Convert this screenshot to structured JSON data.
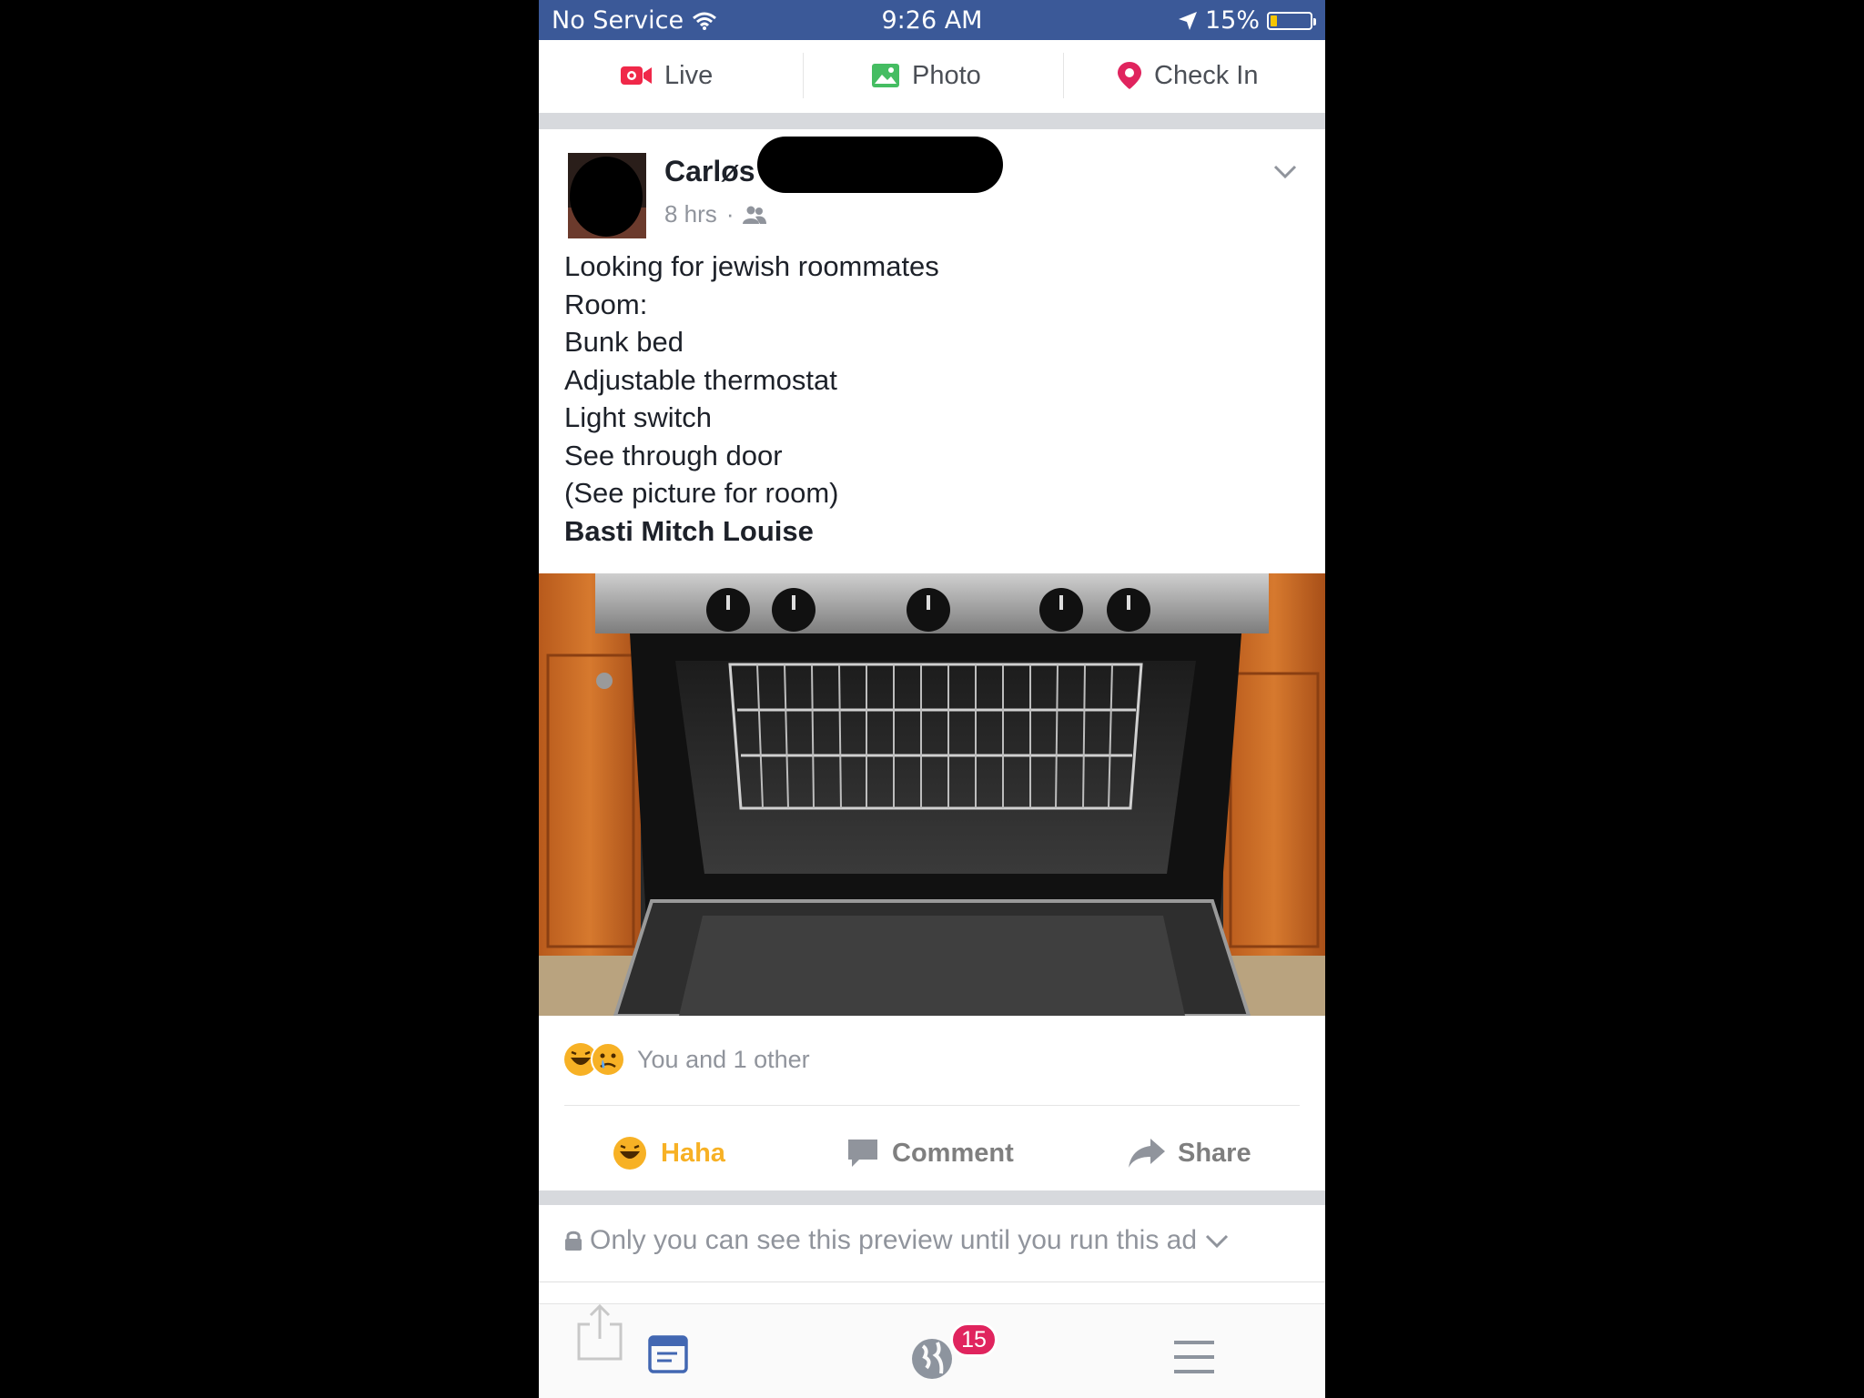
{
  "status_bar": {
    "carrier": "No Service",
    "time": "9:26 AM",
    "battery_percent": "15%",
    "battery_level": 0.15
  },
  "composer": {
    "live_label": "Live",
    "photo_label": "Photo",
    "checkin_label": "Check In"
  },
  "post": {
    "author": "Carløs",
    "time": "8 hrs",
    "lines": [
      "Looking for jewish roommates",
      "Room:",
      "Bunk bed",
      "Adjustable thermostat",
      "Light switch",
      "See through door",
      "(See picture for room)"
    ],
    "tagged": "Basti Mitch Louise",
    "reaction_summary": "You and 1 other",
    "actions": {
      "haha": "Haha",
      "comment": "Comment",
      "share": "Share"
    }
  },
  "ad_note": "Only you can see this preview until you run this ad",
  "tabbar": {
    "notification_count": "15"
  },
  "colors": {
    "brand": "#3b5998",
    "haha": "#f7b125",
    "badge": "#e0245e",
    "live": "#f02849"
  }
}
